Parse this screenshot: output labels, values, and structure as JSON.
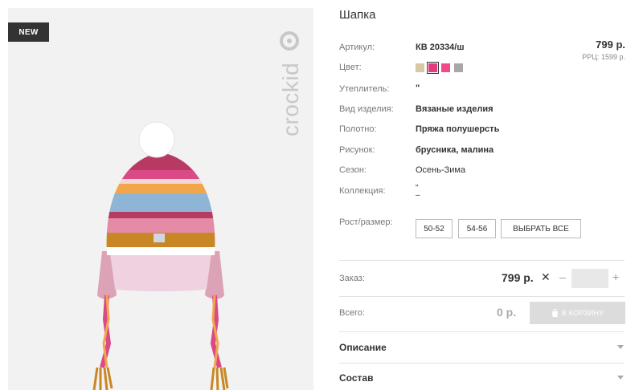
{
  "badge": "NEW",
  "brand": "crockid",
  "product": {
    "title": "Шапка",
    "price": "799 р.",
    "rrp": "РРЦ: 1599 р."
  },
  "specs": [
    {
      "label": "Артикул:",
      "value": "КВ 20334/ш"
    },
    {
      "label": "Цвет:",
      "value": ""
    },
    {
      "label": "Утеплитель:",
      "value": "\""
    },
    {
      "label": "Вид изделия:",
      "value": "Вязаные изделия"
    },
    {
      "label": "Полотно:",
      "value": "Пряжа полушерсть"
    },
    {
      "label": "Рисунок:",
      "value": "брусника, малина"
    },
    {
      "label": "Сезон:",
      "value": "Осень-Зима"
    },
    {
      "label": "Коллекция:",
      "value": "\"\n–"
    }
  ],
  "colors": [
    {
      "name": "beige",
      "hex": "#d8c8a6",
      "selected": false
    },
    {
      "name": "raspberry",
      "hex": "#e33b7c",
      "selected": true
    },
    {
      "name": "pink",
      "hex": "#f04a8a",
      "selected": false
    },
    {
      "name": "grey",
      "hex": "#a8a8a8",
      "selected": false
    }
  ],
  "size": {
    "label": "Рост/размер:",
    "options": [
      "50-52",
      "54-56"
    ],
    "select_all": "ВЫБРАТЬ ВСЕ"
  },
  "order": {
    "label": "Заказ:",
    "price": "799 р.",
    "times": "✕",
    "minus": "–",
    "plus": "+",
    "quantity": ""
  },
  "total": {
    "label": "Всего:",
    "price": "0 р.",
    "cart_button": "В КОРЗИНУ",
    "cart_icon": "shopping-bag-icon"
  },
  "accordion": [
    {
      "title": "Описание",
      "icon": "chevron-down-icon"
    },
    {
      "title": "Состав",
      "icon": "chevron-down-icon"
    }
  ]
}
